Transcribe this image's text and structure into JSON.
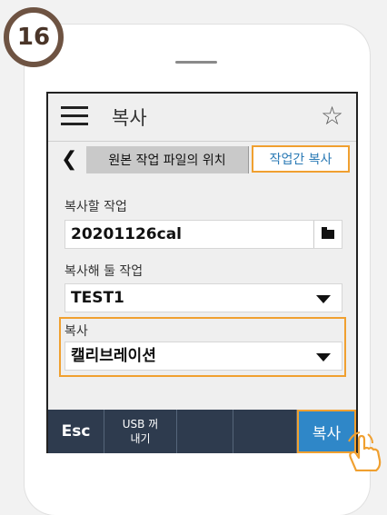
{
  "step_number": "16",
  "header": {
    "title": "복사"
  },
  "tabs": {
    "source_label": "원본 작업 파일의 위치",
    "active_label": "작업간 복사"
  },
  "form": {
    "source_job_label": "복사할 작업",
    "source_job_value": "20201126cal",
    "target_job_label": "복사해 둘 작업",
    "target_job_value": "TEST1",
    "copy_label": "복사",
    "copy_value": "캘리브레이션"
  },
  "bottom_bar": {
    "esc_label": "Esc",
    "usb_line1": "USB 꺼",
    "usb_line2": "내기",
    "copy_button": "복사"
  },
  "colors": {
    "highlight": "#f0a030",
    "bottom_bar": "#2e3b4e",
    "accent": "#2f87c8",
    "badge": "#6e5342"
  },
  "icons": [
    "hamburger-menu-icon",
    "star-icon",
    "chevron-left-icon",
    "folder-icon",
    "dropdown-caret-icon",
    "hand-pointer-icon"
  ]
}
